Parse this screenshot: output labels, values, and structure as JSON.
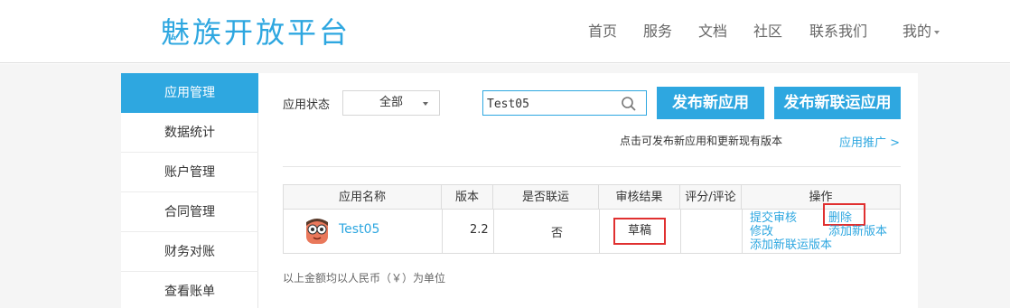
{
  "header": {
    "logo": "魅族开放平台",
    "nav": [
      "首页",
      "服务",
      "文档",
      "社区",
      "联系我们"
    ],
    "me": "我的"
  },
  "sidebar": {
    "items": [
      {
        "label": "应用管理",
        "active": true
      },
      {
        "label": "数据统计"
      },
      {
        "label": "账户管理"
      },
      {
        "label": "合同管理"
      },
      {
        "label": "财务对账"
      },
      {
        "label": "查看账单"
      }
    ]
  },
  "filters": {
    "status_label": "应用状态",
    "status_value": "全部",
    "search_value": "Test05"
  },
  "buttons": {
    "publish_app": "发布新应用",
    "publish_joint": "发布新联运应用"
  },
  "hint": "点击可发布新应用和更新现有版本",
  "promo_link": "应用推广 >",
  "table": {
    "headers": [
      "应用名称",
      "版本",
      "是否联运",
      "审核结果",
      "评分/评论",
      "操作"
    ],
    "row": {
      "name": "Test05",
      "version": "2.2",
      "joint": "否",
      "review": "草稿",
      "rating": "",
      "ops": {
        "submit": "提交审核",
        "delete": "删除",
        "edit": "修改",
        "add_version": "添加新版本",
        "add_joint_version": "添加新联运版本"
      }
    }
  },
  "unit_note": "以上金额均以人民币（￥）为单位",
  "colors": {
    "accent": "#2ea7e0",
    "highlight": "#e03030"
  }
}
